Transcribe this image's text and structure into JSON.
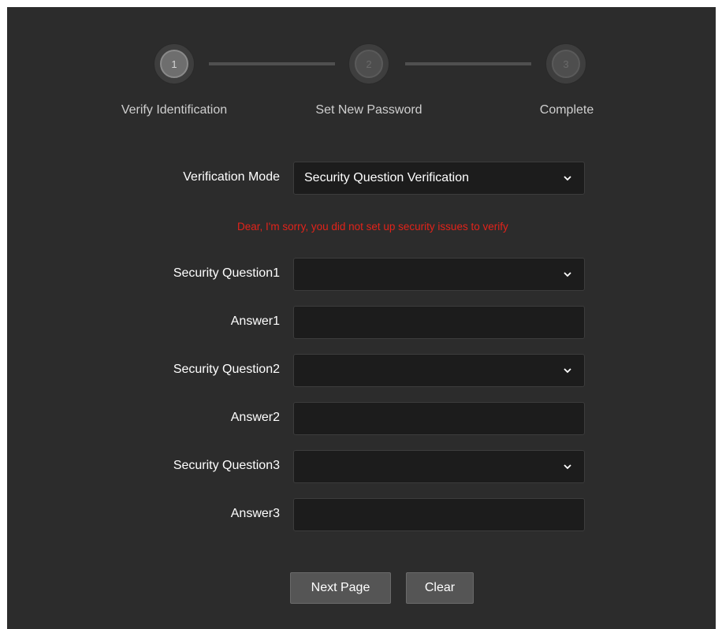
{
  "stepper": {
    "steps": [
      {
        "number": "1",
        "label": "Verify Identification",
        "state": "active"
      },
      {
        "number": "2",
        "label": "Set New Password",
        "state": "inactive"
      },
      {
        "number": "3",
        "label": "Complete",
        "state": "inactive"
      }
    ]
  },
  "form": {
    "verification_mode": {
      "label": "Verification Mode",
      "value": "Security Question Verification"
    },
    "error_message": "Dear, I'm sorry, you did not set up security issues to verify",
    "question1": {
      "label": "Security Question1",
      "value": ""
    },
    "answer1": {
      "label": "Answer1",
      "value": ""
    },
    "question2": {
      "label": "Security Question2",
      "value": ""
    },
    "answer2": {
      "label": "Answer2",
      "value": ""
    },
    "question3": {
      "label": "Security Question3",
      "value": ""
    },
    "answer3": {
      "label": "Answer3",
      "value": ""
    }
  },
  "buttons": {
    "next_label": "Next Page",
    "clear_label": "Clear"
  },
  "colors": {
    "background": "#2c2c2c",
    "field_background": "#1c1c1c",
    "error": "#e3231a",
    "button": "#555555"
  },
  "icons": {
    "dropdown": "chevron-down-icon"
  }
}
